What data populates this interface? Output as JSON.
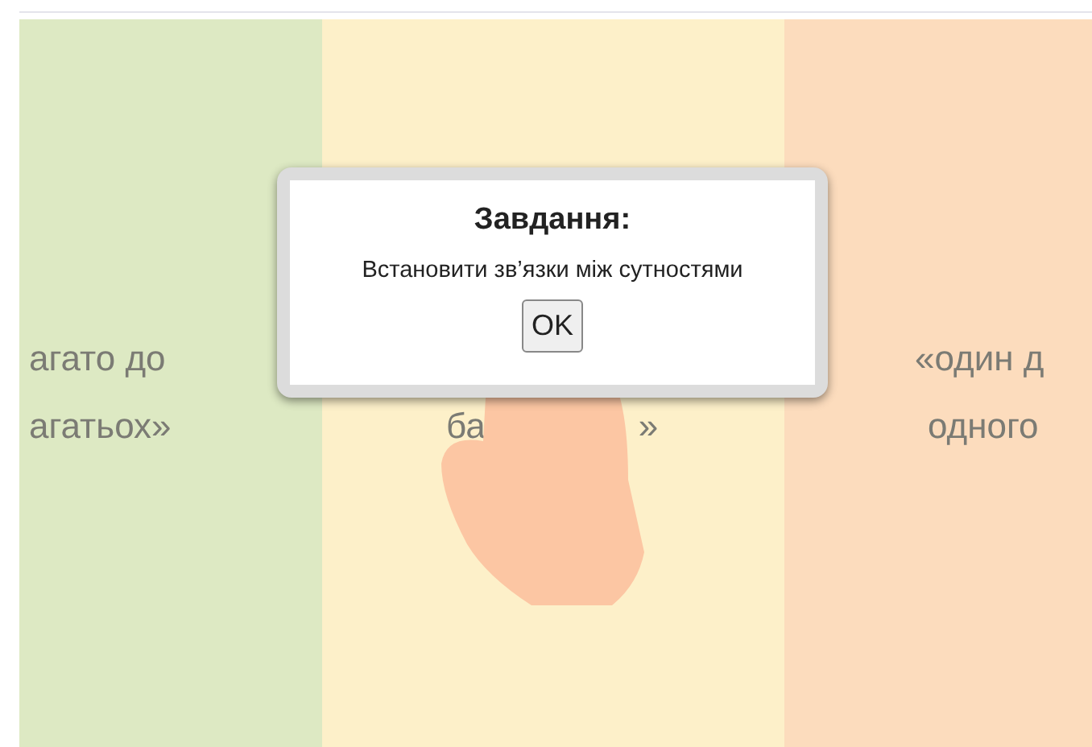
{
  "columns": [
    {
      "color": "#dde9c3",
      "kind": "plain",
      "lines": [
        {
          "parts": [
            "агато до"
          ]
        },
        {
          "parts": [
            "агатьох»"
          ]
        }
      ]
    },
    {
      "color": "#fdf0c9",
      "kind": "split",
      "lines": [
        {
          "parts": [
            "ба",
            "»"
          ]
        }
      ]
    },
    {
      "color": "#fcdcbd",
      "kind": "plain",
      "lines": [
        {
          "parts": [
            "«один д"
          ]
        },
        {
          "parts": [
            "одного"
          ]
        }
      ]
    }
  ],
  "dialog": {
    "title": "Завдання:",
    "message": "Встановити зв’язки між сутностями",
    "button": "OK"
  }
}
